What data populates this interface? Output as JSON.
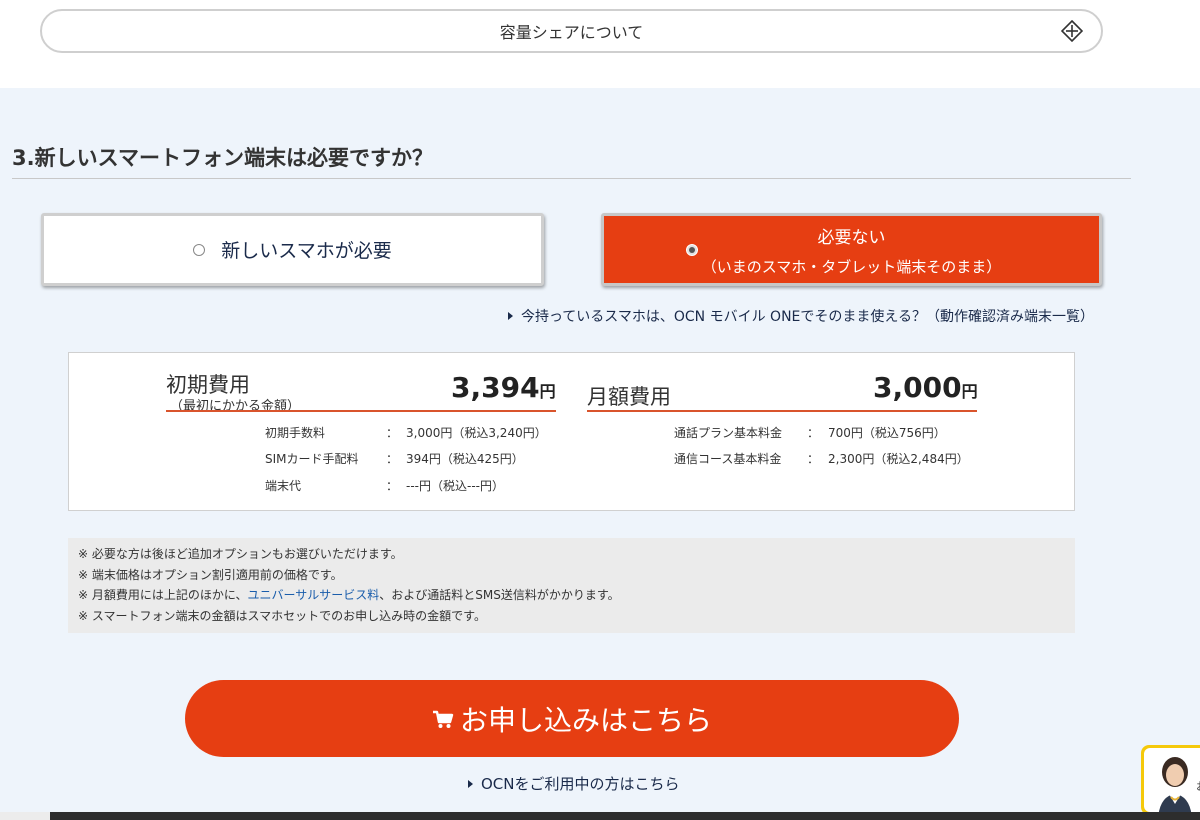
{
  "share_toggle": {
    "label": "容量シェアについて",
    "icon": "plus-circle-icon"
  },
  "section": {
    "title": "3.新しいスマートフォン端末は必要ですか？"
  },
  "options": {
    "new_phone": {
      "label": "新しいスマホが必要",
      "selected": false
    },
    "not_needed": {
      "label": "必要ない",
      "sub_label": "（いまのスマホ・タブレット端末そのまま）",
      "selected": true
    }
  },
  "compat_link": "今持っているスマホは、OCN モバイル ONEでそのまま使える？（動作確認済み端末一覧）",
  "fees": {
    "initial": {
      "title": "初期費用",
      "subtitle": "（最初にかかる金額）",
      "amount": "3,394",
      "unit": "円",
      "rows": [
        {
          "label": "初期手数料",
          "sep": "：",
          "value": "3,000円（税込3,240円）"
        },
        {
          "label": "SIMカード手配料",
          "sep": "：",
          "value": "394円（税込425円）"
        },
        {
          "label": "端末代",
          "sep": "：",
          "value": "---円（税込---円）"
        }
      ]
    },
    "monthly": {
      "title": "月額費用",
      "amount": "3,000",
      "unit": "円",
      "rows": [
        {
          "label": "通話プラン基本料金",
          "sep": "：",
          "value": "700円（税込756円）"
        },
        {
          "label": "通信コース基本料金",
          "sep": "：",
          "value": "2,300円（税込2,484円）"
        }
      ]
    }
  },
  "notes": {
    "n1": "※ 必要な方は後ほど追加オプションもお選びいただけます。",
    "n2": "※ 端末価格はオプション割引適用前の価格です。",
    "n3_pre": "※ 月額費用には上記のほかに、",
    "n3_link": "ユニバーサルサービス料",
    "n3_post": "、および通話料とSMS送信料がかかります。",
    "n4": "※ スマートフォン端末の金額はスマホセットでのお申し込み時の金額です。"
  },
  "apply_button": {
    "label": "お申し込みはこちら",
    "icon": "cart-icon"
  },
  "ocn_link": "OCNをご利用中の方はこちら",
  "chat_widget": {
    "char": "お"
  },
  "colors": {
    "accent": "#e63e12",
    "link": "#1a5dab",
    "underline": "#d9542c"
  }
}
